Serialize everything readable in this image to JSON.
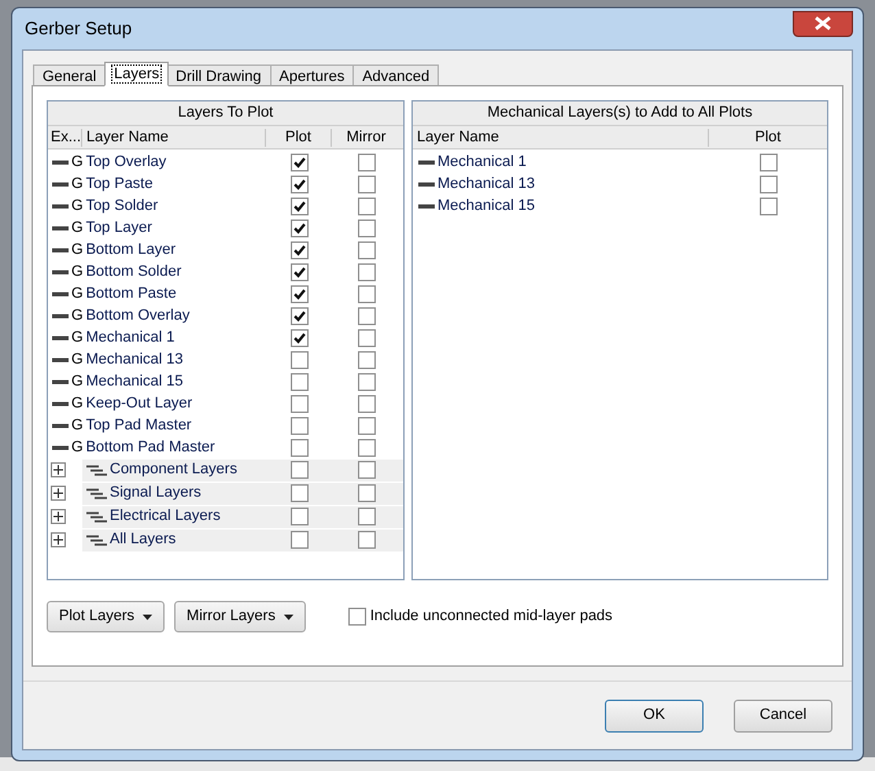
{
  "window": {
    "title": "Gerber Setup"
  },
  "tabs": [
    {
      "label": "General",
      "selected": false
    },
    {
      "label": "Layers",
      "selected": true
    },
    {
      "label": "Drill Drawing",
      "selected": false
    },
    {
      "label": "Apertures",
      "selected": false
    },
    {
      "label": "Advanced",
      "selected": false
    }
  ],
  "layers_to_plot": {
    "title": "Layers To Plot",
    "columns": [
      "Ex...",
      "Layer Name",
      "Plot",
      "Mirror"
    ],
    "rows": [
      {
        "kind": "layer",
        "marker": "G",
        "name": "Top Overlay",
        "plot": true,
        "mirror": false
      },
      {
        "kind": "layer",
        "marker": "G",
        "name": "Top Paste",
        "plot": true,
        "mirror": false
      },
      {
        "kind": "layer",
        "marker": "G",
        "name": "Top Solder",
        "plot": true,
        "mirror": false
      },
      {
        "kind": "layer",
        "marker": "G",
        "name": "Top Layer",
        "plot": true,
        "mirror": false
      },
      {
        "kind": "layer",
        "marker": "G",
        "name": "Bottom Layer",
        "plot": true,
        "mirror": false
      },
      {
        "kind": "layer",
        "marker": "G",
        "name": "Bottom Solder",
        "plot": true,
        "mirror": false
      },
      {
        "kind": "layer",
        "marker": "G",
        "name": "Bottom Paste",
        "plot": true,
        "mirror": false
      },
      {
        "kind": "layer",
        "marker": "G",
        "name": "Bottom Overlay",
        "plot": true,
        "mirror": false
      },
      {
        "kind": "layer",
        "marker": "G",
        "name": "Mechanical 1",
        "plot": true,
        "mirror": false
      },
      {
        "kind": "layer",
        "marker": "G",
        "name": "Mechanical 13",
        "plot": false,
        "mirror": false
      },
      {
        "kind": "layer",
        "marker": "G",
        "name": "Mechanical 15",
        "plot": false,
        "mirror": false
      },
      {
        "kind": "layer",
        "marker": "G",
        "name": "Keep-Out Layer",
        "plot": false,
        "mirror": false
      },
      {
        "kind": "layer",
        "marker": "G",
        "name": "Top Pad Master",
        "plot": false,
        "mirror": false
      },
      {
        "kind": "layer",
        "marker": "G",
        "name": "Bottom Pad Master",
        "plot": false,
        "mirror": false
      },
      {
        "kind": "group",
        "name": "Component Layers",
        "expanded": false,
        "plot": false,
        "mirror": false
      },
      {
        "kind": "group",
        "name": "Signal Layers",
        "expanded": false,
        "plot": false,
        "mirror": false
      },
      {
        "kind": "group",
        "name": "Electrical Layers",
        "expanded": false,
        "plot": false,
        "mirror": false
      },
      {
        "kind": "group",
        "name": "All Layers",
        "expanded": false,
        "plot": false,
        "mirror": false
      }
    ]
  },
  "mechanical_layers": {
    "title": "Mechanical Layers(s) to Add to All Plots",
    "columns": [
      "Layer Name",
      "Plot"
    ],
    "rows": [
      {
        "name": "Mechanical 1",
        "plot": false
      },
      {
        "name": "Mechanical 13",
        "plot": false
      },
      {
        "name": "Mechanical 15",
        "plot": false
      }
    ]
  },
  "dropdown_buttons": [
    {
      "label": "Plot Layers"
    },
    {
      "label": "Mirror Layers"
    }
  ],
  "include_pads": {
    "label": "Include unconnected mid-layer pads",
    "checked": false
  },
  "buttons": [
    {
      "label": "OK",
      "default": true
    },
    {
      "label": "Cancel",
      "default": false
    }
  ]
}
